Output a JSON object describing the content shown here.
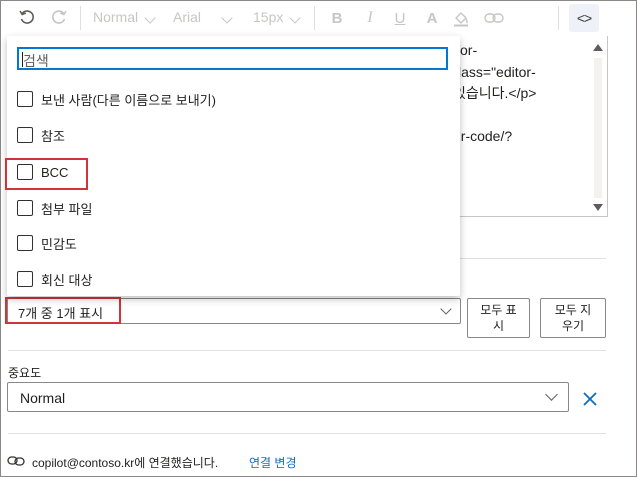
{
  "toolbar": {
    "font_style": "Normal",
    "font_family": "Arial",
    "font_size": "15px",
    "code_view_label": "<>"
  },
  "editor": {
    "lines": [
      "itor-",
      "class=\"editor-",
      "있습니다.</p>",
      "",
      "qr-code/?"
    ]
  },
  "popup": {
    "search_placeholder": "검색",
    "options": [
      {
        "label": "보낸 사람(다른 이름으로 보내기)",
        "checked": false
      },
      {
        "label": "참조",
        "checked": false
      },
      {
        "label": "BCC",
        "checked": false
      },
      {
        "label": "첨부 파일",
        "checked": false
      },
      {
        "label": "민감도",
        "checked": false
      },
      {
        "label": "회신 대상",
        "checked": false
      }
    ]
  },
  "field_select": {
    "value": "7개 중 1개 표시"
  },
  "buttons": {
    "show_all": "모두 표\n시",
    "hide_all": "모두 지\n우기"
  },
  "importance": {
    "label": "중요도",
    "value": "Normal"
  },
  "footer": {
    "connected_text": "copilot@contoso.kr에 연결했습니다.",
    "change_link": "연결 변경"
  },
  "colors": {
    "accent": "#0078d4",
    "highlight": "#d13438",
    "link": "#0f6cbd"
  }
}
